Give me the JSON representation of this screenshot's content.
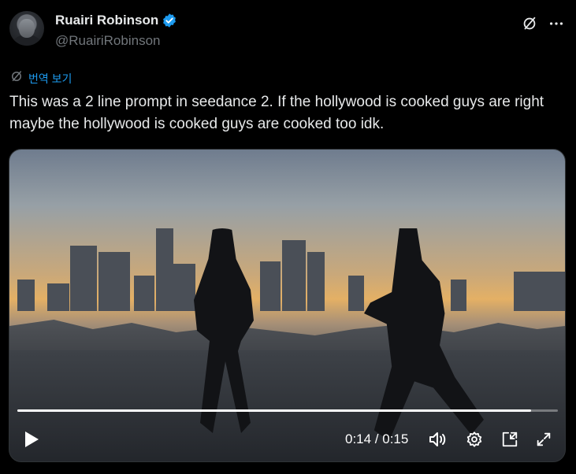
{
  "author": {
    "name": "Ruairi Robinson",
    "handle": "@RuairiRobinson",
    "verified_icon": "verified-badge-icon",
    "verified_color": "#1d9bf0"
  },
  "header_icons": [
    "grok-icon",
    "more-icon"
  ],
  "translate": {
    "label": "번역 보기",
    "icon": "translate-icon"
  },
  "tweet": {
    "text": "This was a 2 line prompt in seedance 2. If the hollywood is cooked guys are right maybe the hollywood is cooked guys are cooked too idk."
  },
  "video": {
    "time_display": "0:14 / 0:15",
    "progress_fraction": 0.95,
    "controls": [
      "play-icon",
      "volume-icon",
      "settings-icon",
      "picture-in-picture-icon",
      "fullscreen-icon"
    ]
  },
  "colors": {
    "background": "#000000",
    "text": "#e7e9ea",
    "secondary": "#71767b",
    "accent": "#1d9bf0"
  }
}
